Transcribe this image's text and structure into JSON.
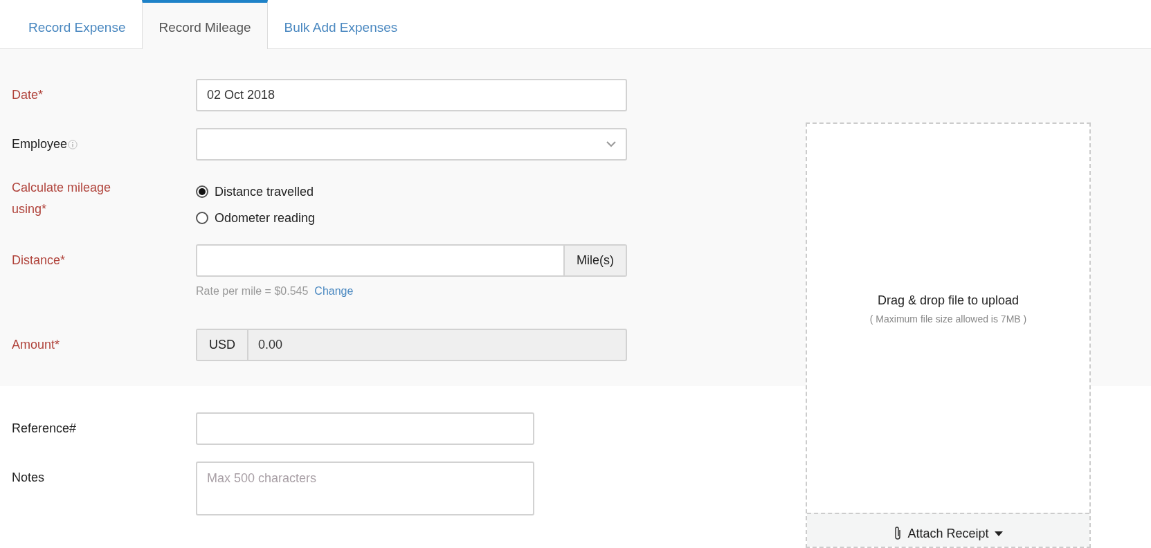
{
  "tabs": [
    {
      "label": "Record Expense",
      "selected": false
    },
    {
      "label": "Record Mileage",
      "selected": true
    },
    {
      "label": "Bulk Add Expenses",
      "selected": false
    }
  ],
  "sections": [
    {
      "shaded": true,
      "fields": [
        {
          "kind": "text",
          "label": "Date*",
          "required": true,
          "value": "02 Oct 2018"
        },
        {
          "kind": "select",
          "label": "Employee",
          "required": false,
          "info": true
        },
        {
          "kind": "radio",
          "label": "Calculate mileage using*",
          "required": true,
          "options": [
            {
              "label": "Distance travelled",
              "selected": true
            },
            {
              "label": "Odometer reading",
              "selected": false
            }
          ]
        },
        {
          "kind": "unit",
          "label": "Distance*",
          "required": true,
          "suffix": "Mile(s)",
          "hint": "Rate per mile = $0.545",
          "link": "Change"
        },
        {
          "kind": "currency",
          "label": "Amount*",
          "required": true,
          "prefix": "USD",
          "value": "0.00",
          "disabled": true
        }
      ]
    },
    {
      "shaded": false,
      "fields": [
        {
          "kind": "short",
          "label": "Reference#",
          "required": false
        },
        {
          "kind": "textarea",
          "label": "Notes",
          "required": false,
          "placeholder": "Max 500 characters"
        }
      ]
    }
  ],
  "upload": {
    "title": "Drag & drop file to upload",
    "note": "( Maximum file size allowed is 7MB )",
    "button": "Attach Receipt"
  }
}
